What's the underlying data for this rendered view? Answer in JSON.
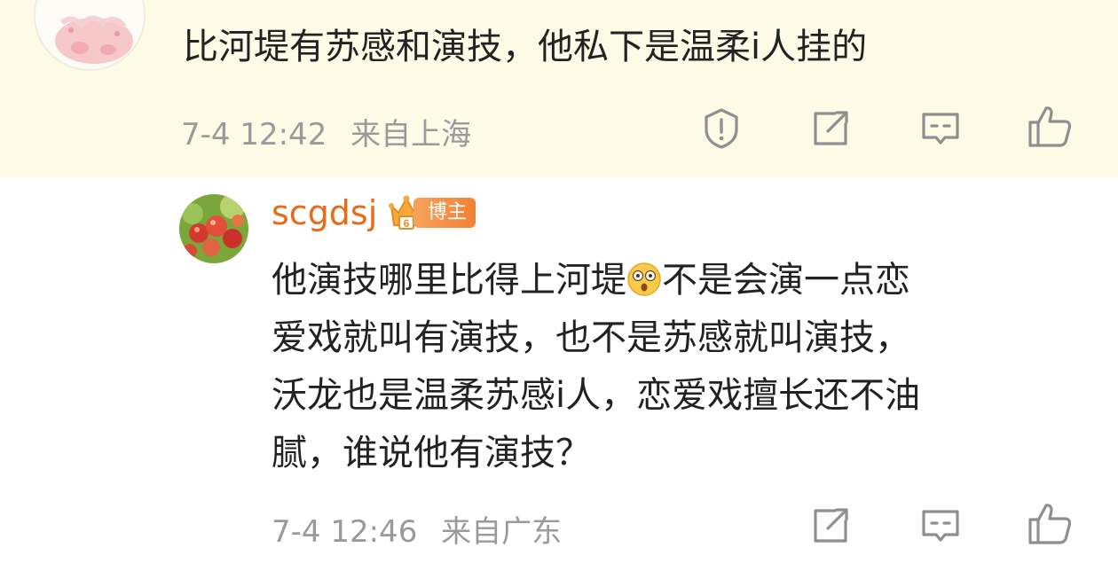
{
  "top_comment": {
    "text": "比河堤有苏感和演技，他私下是温柔i人挂的",
    "time": "7-4 12:42",
    "location": "来自上海",
    "background": "#fdfae6"
  },
  "reply": {
    "username": "scgdsj",
    "badge": "博主",
    "text_lines": [
      "他演技哪里比得上河堤",
      "不是会演一点恋",
      "爱戏就叫有演技，也不是苏感就叫演技，",
      "沃龙也是温柔苏感i人，恋爱戏擅长还不油",
      "腻，谁说他有演技？"
    ],
    "time": "7-4 12:46",
    "location": "来自广东"
  },
  "icons": {
    "report": "exclamation-shield-icon",
    "share": "share-square-icon",
    "comment": "comment-bubble-icon",
    "like": "thumbs-up-icon"
  },
  "colors": {
    "username": "#e86b1b",
    "meta": "#9a9a9a",
    "icon": "#8f8f8f"
  }
}
